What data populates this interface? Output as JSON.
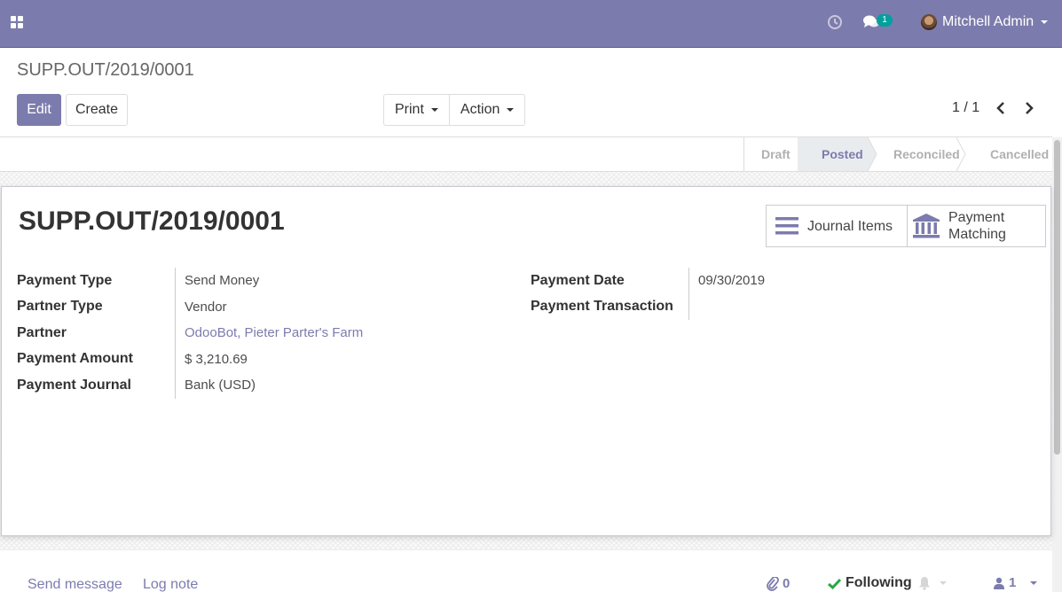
{
  "navbar": {
    "apps_icon": "apps-grid-icon",
    "activity_icon": "clock-icon",
    "messages_icon": "chat-icon",
    "messages_count": "1",
    "user_name": "Mitchell Admin",
    "color": "#7c7bad"
  },
  "control_panel": {
    "breadcrumb": "SUPP.OUT/2019/0001",
    "edit_label": "Edit",
    "create_label": "Create",
    "print_label": "Print",
    "action_label": "Action",
    "pager": "1 / 1"
  },
  "statusbar": {
    "steps": [
      "Draft",
      "Posted",
      "Reconciled",
      "Cancelled"
    ],
    "active": "Posted"
  },
  "form": {
    "title": "SUPP.OUT/2019/0001",
    "smart_buttons": [
      {
        "label": "Journal Items",
        "icon": "list-icon"
      },
      {
        "label_line1": "Payment",
        "label_line2": "Matching",
        "icon": "bank-icon"
      }
    ],
    "left_fields": [
      {
        "label": "Payment Type",
        "value": "Send Money"
      },
      {
        "label": "Partner Type",
        "value": "Vendor"
      },
      {
        "label": "Partner",
        "value": "OdooBot, Pieter Parter's Farm"
      },
      {
        "label": "Payment Amount",
        "value": "$ 3,210.69"
      },
      {
        "label": "Payment Journal",
        "value": "Bank (USD)"
      }
    ],
    "right_fields": [
      {
        "label": "Payment Date",
        "value": "09/30/2019"
      },
      {
        "label": "Payment Transaction",
        "value": ""
      }
    ]
  },
  "chatter": {
    "send_message": "Send message",
    "log_note": "Log note",
    "attachments_count": "0",
    "following_label": "Following",
    "followers_count": "1"
  }
}
